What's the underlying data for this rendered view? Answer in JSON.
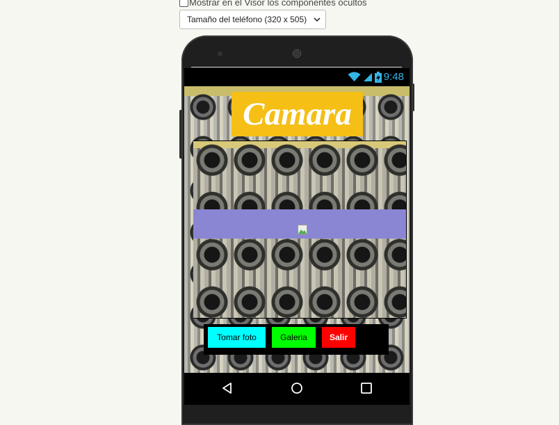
{
  "designer": {
    "show_hidden_label": "Mostrar en el Visor los componentes ocultos",
    "show_hidden_checked": false,
    "phone_size_selected": "Tamaño del teléfono (320 x 505)"
  },
  "status_bar": {
    "time": "9:48",
    "icons": [
      "wifi-icon",
      "signal-icon",
      "battery-charging-icon"
    ],
    "icon_color": "#33b5e5"
  },
  "app": {
    "title": "Camara",
    "title_bg": "#f5bf16",
    "buttons": {
      "tomar_foto": "Tomar foto",
      "galeria": "Galeria",
      "salir": "Salir"
    },
    "button_colors": {
      "tomar_foto": "#00ffff",
      "galeria": "#00ff00",
      "salir": "#ff0000"
    }
  },
  "nav_bar": {
    "icons": [
      "back-icon",
      "home-icon",
      "recents-icon"
    ]
  }
}
